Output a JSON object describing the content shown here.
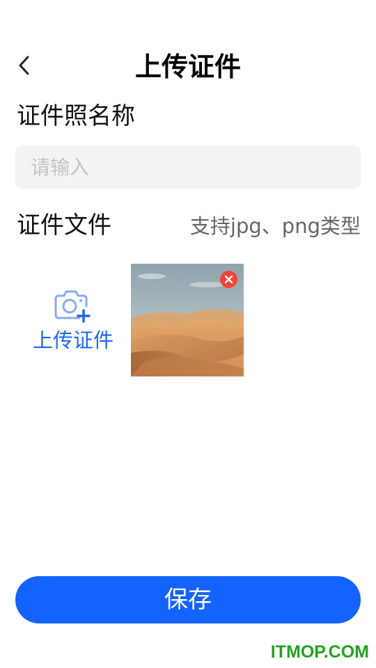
{
  "header": {
    "back_icon": "chevron-left-icon",
    "title": "上传证件"
  },
  "form": {
    "name_label": "证件照名称",
    "name_placeholder": "请输入",
    "name_value": "",
    "file_label": "证件文件",
    "file_hint": "支持jpg、png类型",
    "upload": {
      "icon": "camera-plus-icon",
      "label": "上传证件"
    },
    "thumbnail": {
      "content": "desert-dunes-photo",
      "remove_icon": "close-icon",
      "remove_color": "#f0453a"
    }
  },
  "footer": {
    "save_label": "保存",
    "save_color": "#1463ff"
  },
  "watermark": {
    "text": "ITMOP.COM",
    "color": "#21a320"
  }
}
